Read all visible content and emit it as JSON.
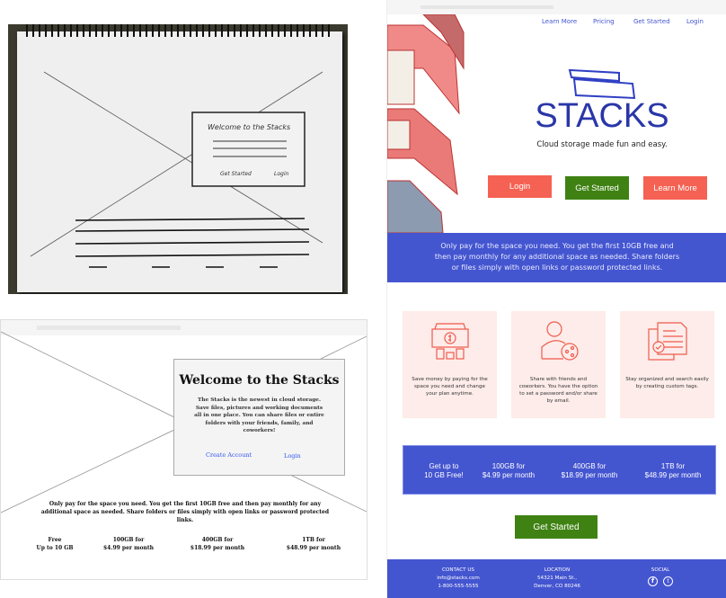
{
  "sketch": {
    "title": "Welcome to the Stacks",
    "get_started": "Get Started",
    "login": "Login"
  },
  "wireframe": {
    "title": "Welcome to the Stacks",
    "body": "The Stacks is the newest in cloud storage. Save files, pictures and working documents all in one place. You can share files or entire folders with your friends, family, and coworkers!",
    "create_account": "Create Account",
    "login": "Login",
    "description": "Only pay for the space you need. You get the first 10GB free and then pay monthly for any additional space as needed.  Share folders or files simply with open links or password protected links.",
    "prices": [
      {
        "l1": "Free",
        "l2": "Up to 10 GB"
      },
      {
        "l1": "100GB for",
        "l2": "$4.99 per month"
      },
      {
        "l1": "400GB  for",
        "l2": "$18.99 per month"
      },
      {
        "l1": "1TB for",
        "l2": "$48.99 per month"
      }
    ]
  },
  "mockup": {
    "nav": [
      "Learn More",
      "Pricing",
      "Get Started",
      "Login"
    ],
    "brand": "STACKS",
    "tagline": "Cloud storage made fun and easy.",
    "buttons": {
      "login": "Login",
      "get_started": "Get Started",
      "learn_more": "Learn More"
    },
    "banner": "Only pay for the space you need. You get the first 10GB free and then pay monthly for any additional space as needed.  Share folders or files simply with open links or password protected links.",
    "features": [
      {
        "icon": "money-icon",
        "text": "Save money by paying for the space you need and change your plan anytime."
      },
      {
        "icon": "share-user-icon",
        "text": "Share with friends and coworkers. You have the option to set a password and/or share by email."
      },
      {
        "icon": "documents-icon",
        "text": "Stay organized and search easily by creating custom tags."
      }
    ],
    "prices": [
      {
        "l1": "Get up to",
        "l2": "10 GB Free!"
      },
      {
        "l1": "100GB for",
        "l2": "$4.99 per month"
      },
      {
        "l1": "400GB  for",
        "l2": "$18.99 per month"
      },
      {
        "l1": "1TB for",
        "l2": "$48.99 per month"
      }
    ],
    "cta": "Get Started",
    "footer": {
      "contact": {
        "heading": "CONTACT US",
        "email": "info@stacks.com",
        "phone": "1-800-555-5555"
      },
      "location": {
        "heading": "LOCATION",
        "street": "54321  Main St.,",
        "city": "Denver, CO 80246"
      },
      "social": {
        "heading": "SOCIAL",
        "icons": [
          "facebook-icon",
          "twitter-icon"
        ]
      }
    },
    "colors": {
      "blue": "#4455d0",
      "coral": "#f56152",
      "green": "#3f8213",
      "card": "#fdecea"
    }
  }
}
